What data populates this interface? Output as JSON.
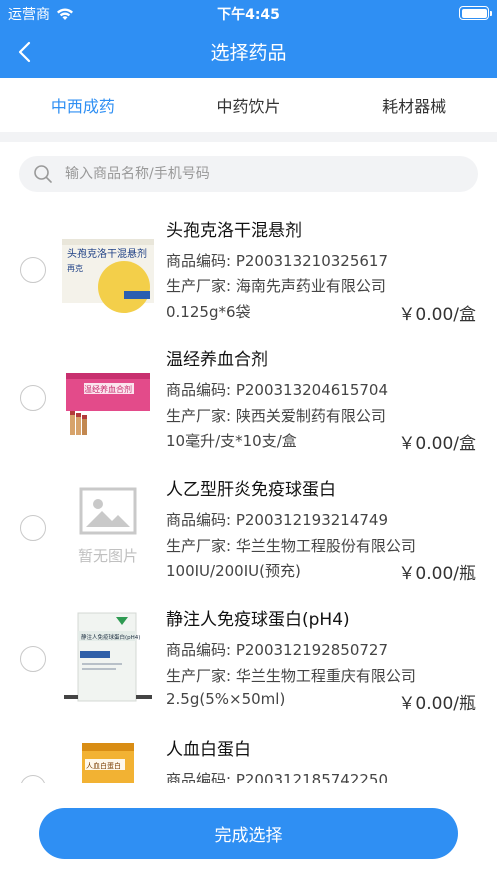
{
  "status_bar": {
    "carrier": "运营商",
    "time": "下午4:45"
  },
  "nav": {
    "title": "选择药品"
  },
  "tabs": [
    {
      "label": "中西成药",
      "active": true
    },
    {
      "label": "中药饮片",
      "active": false
    },
    {
      "label": "耗材器械",
      "active": false
    }
  ],
  "search": {
    "placeholder": "输入商品名称/手机号码"
  },
  "items": [
    {
      "name": "头孢克洛干混悬剂",
      "code": "商品编码: P200313210325617",
      "maker": "生产厂家: 海南先声药业有限公司",
      "spec": "0.125g*6袋",
      "price": "￥0.00/盒",
      "image_text": "头孢克洛干混悬剂",
      "image_brand": "再克"
    },
    {
      "name": "温经养血合剂",
      "code": "商品编码: P200313204615704",
      "maker": "生产厂家: 陕西关爱制药有限公司",
      "spec": "10毫升/支*10支/盒",
      "price": "￥0.00/盒",
      "image_text": "温经养血合剂"
    },
    {
      "name": "人乙型肝炎免疫球蛋白",
      "code": "商品编码: P200312193214749",
      "maker": "生产厂家: 华兰生物工程股份有限公司",
      "spec": "100IU/200IU(预充)",
      "price": "￥0.00/瓶",
      "no_image_text": "暂无图片"
    },
    {
      "name": "静注人免疫球蛋白(pH4)",
      "code": "商品编码: P200312192850727",
      "maker": "生产厂家: 华兰生物工程重庆有限公司",
      "spec": "2.5g(5%×50ml)",
      "price": "￥0.00/瓶",
      "image_text": "静注人免疫球蛋白(pH4)"
    },
    {
      "name": "人血白蛋白",
      "code": "商品编码: P200312185742250",
      "image_text": "人血白蛋白"
    }
  ],
  "footer": {
    "done_label": "完成选择"
  },
  "colors": {
    "primary": "#2f8ff3",
    "background_gray": "#f2f3f5"
  }
}
